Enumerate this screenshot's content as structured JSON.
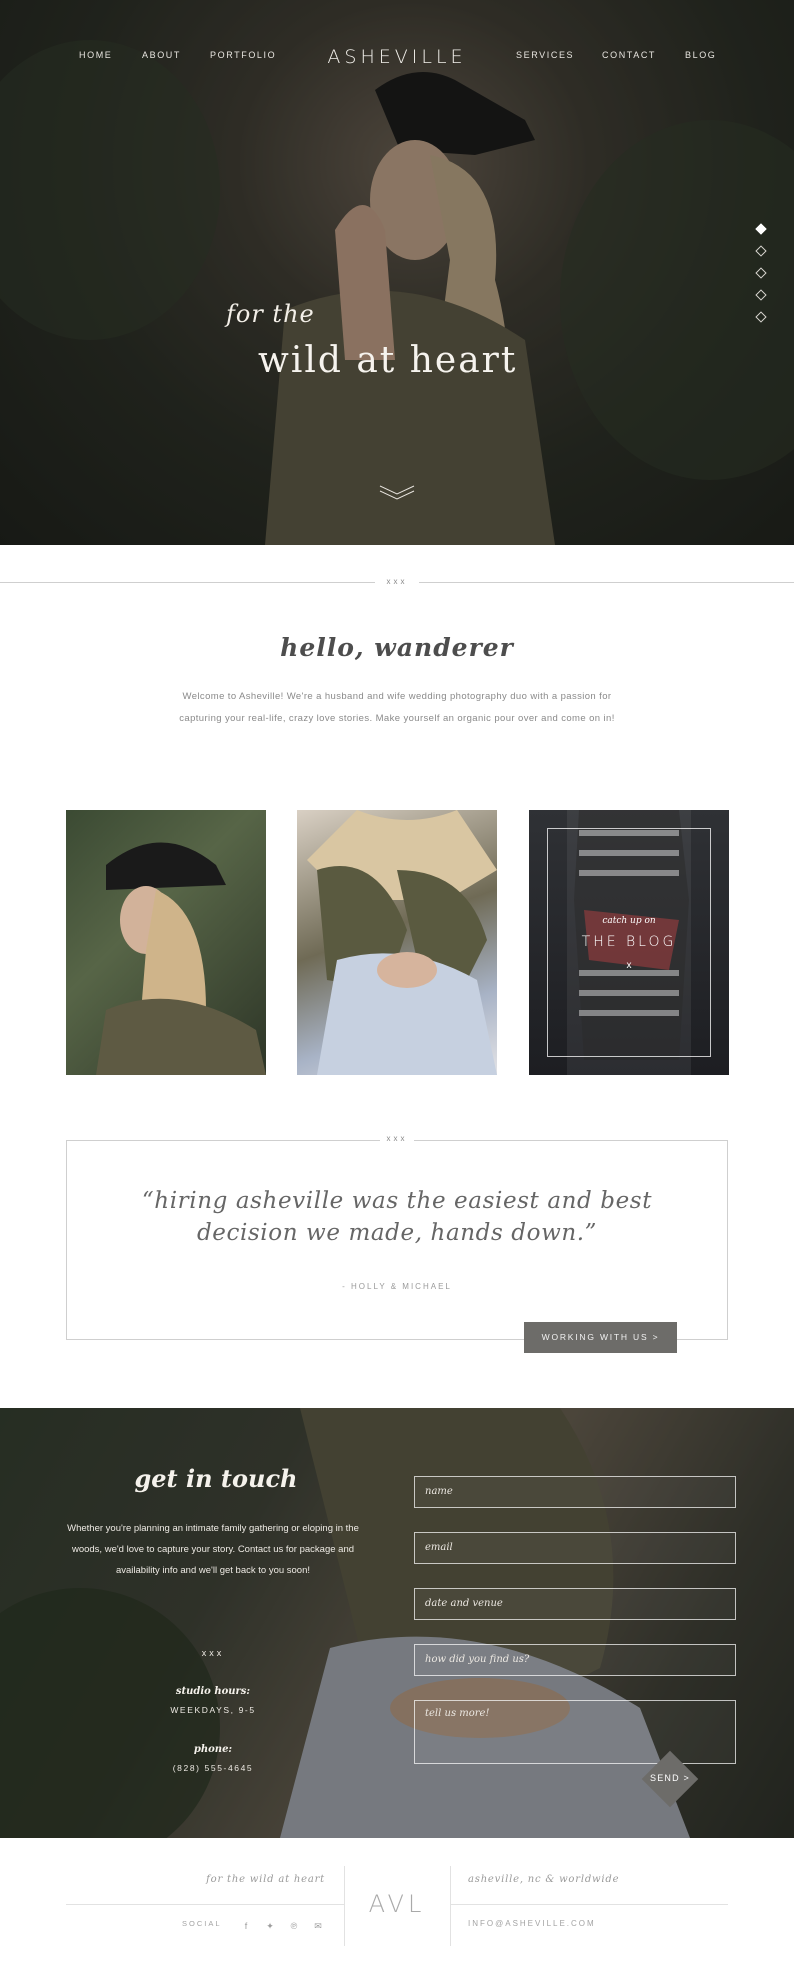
{
  "header": {
    "logo": "ASHEVILLE",
    "nav_left": [
      "HOME",
      "ABOUT",
      "PORTFOLIO"
    ],
    "nav_right": [
      "SERVICES",
      "CONTACT",
      "BLOG"
    ]
  },
  "hero": {
    "tagline_small": "for the",
    "tagline_large": "wild at heart",
    "slide_dots": 5,
    "active_slide": 1
  },
  "divider": {
    "mark": "xxx"
  },
  "intro": {
    "heading": "hello, wanderer",
    "body": "Welcome to Asheville! We're a husband and wife wedding photography duo with a passion for capturing your real-life, crazy love stories. Make yourself an organic pour over and come on in!"
  },
  "blog_tile": {
    "kicker": "catch up on",
    "title": "THE BLOG",
    "mark": "x"
  },
  "testimonial": {
    "mark": "xxx",
    "quote": "“hiring asheville was the easiest and best decision we made, hands down.”",
    "author": "- HOLLY & MICHAEL",
    "button": "WORKING WITH US  >"
  },
  "contact": {
    "heading": "get in touch",
    "body": "Whether you're planning an intimate family gathering or eloping in the woods, we'd love to capture your story. Contact us for package and availability info and we'll get back to you soon!",
    "mark": "xxx",
    "hours_label": "studio hours:",
    "hours_value": "WEEKDAYS, 9-5",
    "phone_label": "phone:",
    "phone_value": "(828) 555-4645",
    "fields": [
      "name",
      "email",
      "date and venue",
      "how did you find us?",
      "tell us more!"
    ],
    "send": "SEND >"
  },
  "footer": {
    "tagline": "for the wild at heart",
    "logo": "AVL",
    "location": "asheville, nc & worldwide",
    "social_label": "SOCIAL",
    "social_icons": [
      "facebook-icon",
      "twitter-icon",
      "pinterest-icon",
      "email-icon"
    ],
    "email": "INFO@ASHEVILLE.COM"
  }
}
